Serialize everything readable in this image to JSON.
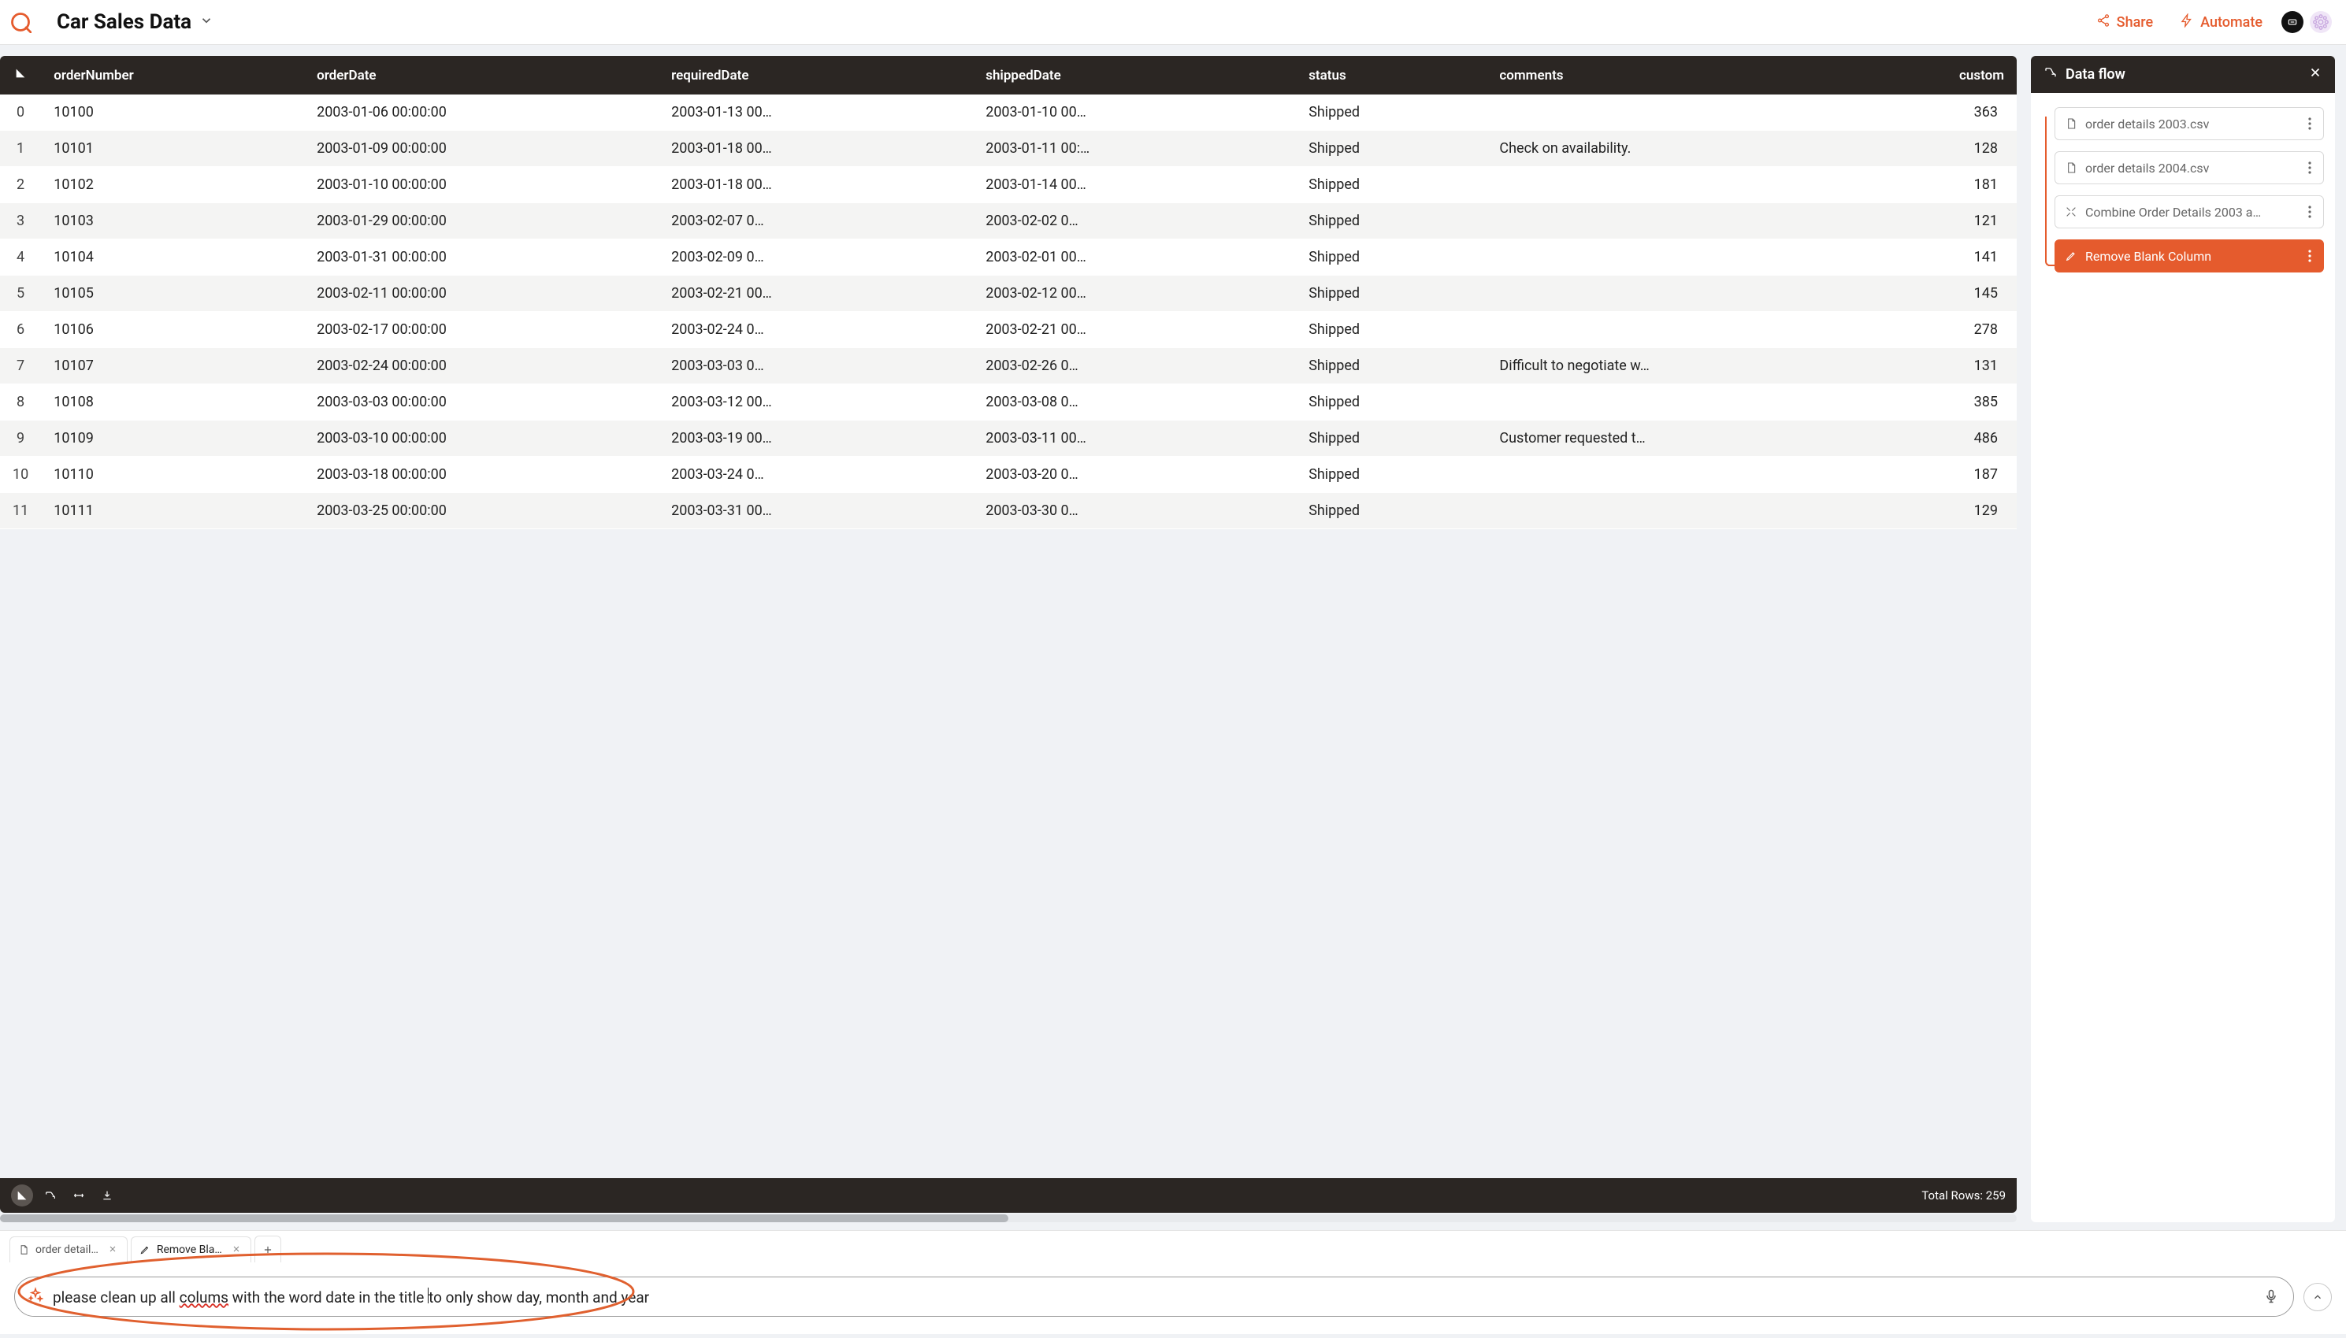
{
  "header": {
    "title": "Car Sales Data",
    "share": "Share",
    "automate": "Automate"
  },
  "table": {
    "columns": [
      "orderNumber",
      "orderDate",
      "requiredDate",
      "shippedDate",
      "status",
      "comments",
      "custom"
    ],
    "lastColumnTruncated": "custom",
    "rows": [
      {
        "idx": "0",
        "orderNumber": "10100",
        "orderDate": "2003-01-06 00:00:00",
        "requiredDate": "2003-01-13 00…",
        "shippedDate": "2003-01-10 00…",
        "status": "Shipped",
        "comments": "",
        "custom": "363"
      },
      {
        "idx": "1",
        "orderNumber": "10101",
        "orderDate": "2003-01-09 00:00:00",
        "requiredDate": "2003-01-18 00…",
        "shippedDate": "2003-01-11 00:…",
        "status": "Shipped",
        "comments": "Check on availability.",
        "custom": "128"
      },
      {
        "idx": "2",
        "orderNumber": "10102",
        "orderDate": "2003-01-10 00:00:00",
        "requiredDate": "2003-01-18 00…",
        "shippedDate": "2003-01-14 00…",
        "status": "Shipped",
        "comments": "",
        "custom": "181"
      },
      {
        "idx": "3",
        "orderNumber": "10103",
        "orderDate": "2003-01-29 00:00:00",
        "requiredDate": "2003-02-07 0…",
        "shippedDate": "2003-02-02 0…",
        "status": "Shipped",
        "comments": "",
        "custom": "121"
      },
      {
        "idx": "4",
        "orderNumber": "10104",
        "orderDate": "2003-01-31 00:00:00",
        "requiredDate": "2003-02-09 0…",
        "shippedDate": "2003-02-01 00…",
        "status": "Shipped",
        "comments": "",
        "custom": "141"
      },
      {
        "idx": "5",
        "orderNumber": "10105",
        "orderDate": "2003-02-11 00:00:00",
        "requiredDate": "2003-02-21 00…",
        "shippedDate": "2003-02-12 00…",
        "status": "Shipped",
        "comments": "",
        "custom": "145"
      },
      {
        "idx": "6",
        "orderNumber": "10106",
        "orderDate": "2003-02-17 00:00:00",
        "requiredDate": "2003-02-24 0…",
        "shippedDate": "2003-02-21 00…",
        "status": "Shipped",
        "comments": "",
        "custom": "278"
      },
      {
        "idx": "7",
        "orderNumber": "10107",
        "orderDate": "2003-02-24 00:00:00",
        "requiredDate": "2003-03-03 0…",
        "shippedDate": "2003-02-26 0…",
        "status": "Shipped",
        "comments": "Difficult to negotiate w…",
        "custom": "131"
      },
      {
        "idx": "8",
        "orderNumber": "10108",
        "orderDate": "2003-03-03 00:00:00",
        "requiredDate": "2003-03-12 00…",
        "shippedDate": "2003-03-08 0…",
        "status": "Shipped",
        "comments": "",
        "custom": "385"
      },
      {
        "idx": "9",
        "orderNumber": "10109",
        "orderDate": "2003-03-10 00:00:00",
        "requiredDate": "2003-03-19 00…",
        "shippedDate": "2003-03-11 00…",
        "status": "Shipped",
        "comments": "Customer requested t…",
        "custom": "486"
      },
      {
        "idx": "10",
        "orderNumber": "10110",
        "orderDate": "2003-03-18 00:00:00",
        "requiredDate": "2003-03-24 0…",
        "shippedDate": "2003-03-20 0…",
        "status": "Shipped",
        "comments": "",
        "custom": "187"
      },
      {
        "idx": "11",
        "orderNumber": "10111",
        "orderDate": "2003-03-25 00:00:00",
        "requiredDate": "2003-03-31 00…",
        "shippedDate": "2003-03-30 0…",
        "status": "Shipped",
        "comments": "",
        "custom": "129"
      }
    ],
    "footer": "Total Rows: 259"
  },
  "sidepanel": {
    "title": "Data flow",
    "items": [
      {
        "label": "order details 2003.csv",
        "icon": "file",
        "active": false
      },
      {
        "label": "order details 2004.csv",
        "icon": "file",
        "active": false
      },
      {
        "label": "Combine Order Details 2003 a…",
        "icon": "combine",
        "active": false
      },
      {
        "label": "Remove Blank Column",
        "icon": "pencil",
        "active": true
      }
    ]
  },
  "tabs": [
    {
      "label": "order detail…",
      "icon": "file",
      "active": false
    },
    {
      "label": "Remove Bla…",
      "icon": "pencil",
      "active": true
    }
  ],
  "prompt": {
    "value_pre": "please clean up all ",
    "value_typo": "colums",
    "value_mid": " with the word date in the title ",
    "value_post": "to only show day, month and year"
  }
}
